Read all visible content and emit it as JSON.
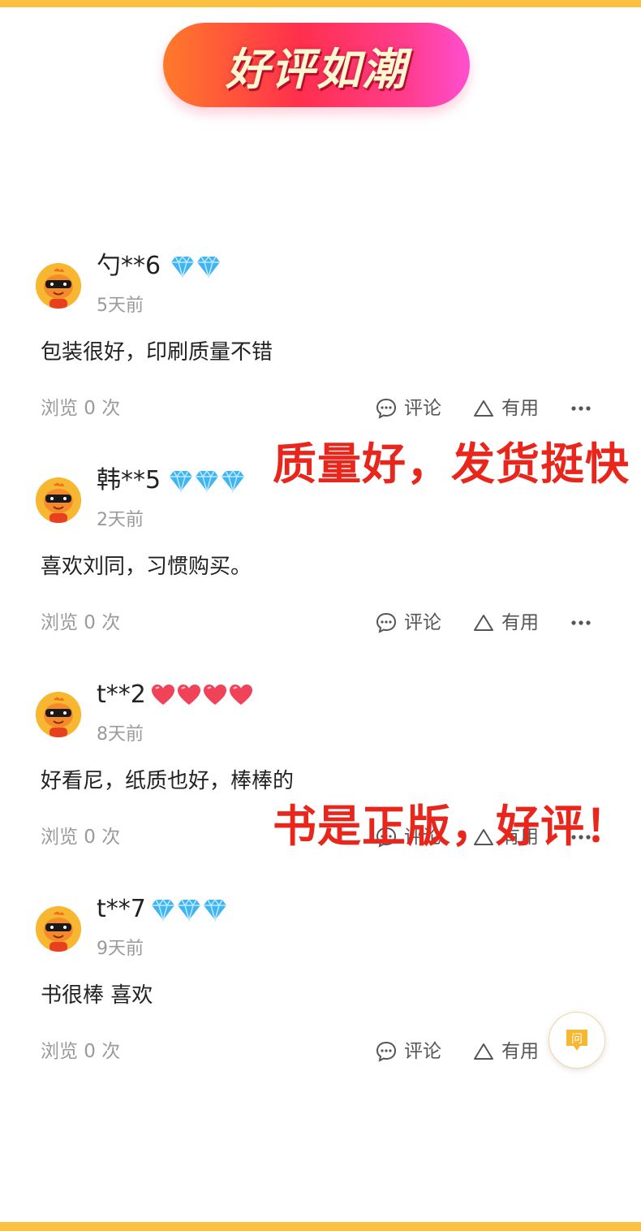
{
  "banner": {
    "title": "好评如潮"
  },
  "overlays": {
    "text1": "质量好，发货挺快",
    "text2": "书是正版，好评！"
  },
  "actions": {
    "comment_label": "评论",
    "useful_label": "有用"
  },
  "reviews": [
    {
      "username": "勺**6",
      "badge_type": "diamond",
      "badge_count": 2,
      "time": "5天前",
      "content": "包装很好，印刷质量不错",
      "views": "浏览 0 次"
    },
    {
      "username": "韩**5",
      "badge_type": "diamond",
      "badge_count": 3,
      "time": "2天前",
      "content": "喜欢刘同，习惯购买。",
      "views": "浏览 0 次"
    },
    {
      "username": "t**2",
      "badge_type": "heart",
      "badge_count": 4,
      "time": "8天前",
      "content": "好看尼，纸质也好，棒棒的",
      "views": "浏览 0 次"
    },
    {
      "username": "t**7",
      "badge_type": "diamond",
      "badge_count": 3,
      "time": "9天前",
      "content": "书很棒 喜欢",
      "views": "浏览 0 次"
    }
  ],
  "ask_button": {
    "label": "问"
  },
  "colors": {
    "border": "#fcc13e",
    "overlay_red": "#e8261c",
    "diamond": "#3fb4f2",
    "heart": "#f0435a"
  }
}
